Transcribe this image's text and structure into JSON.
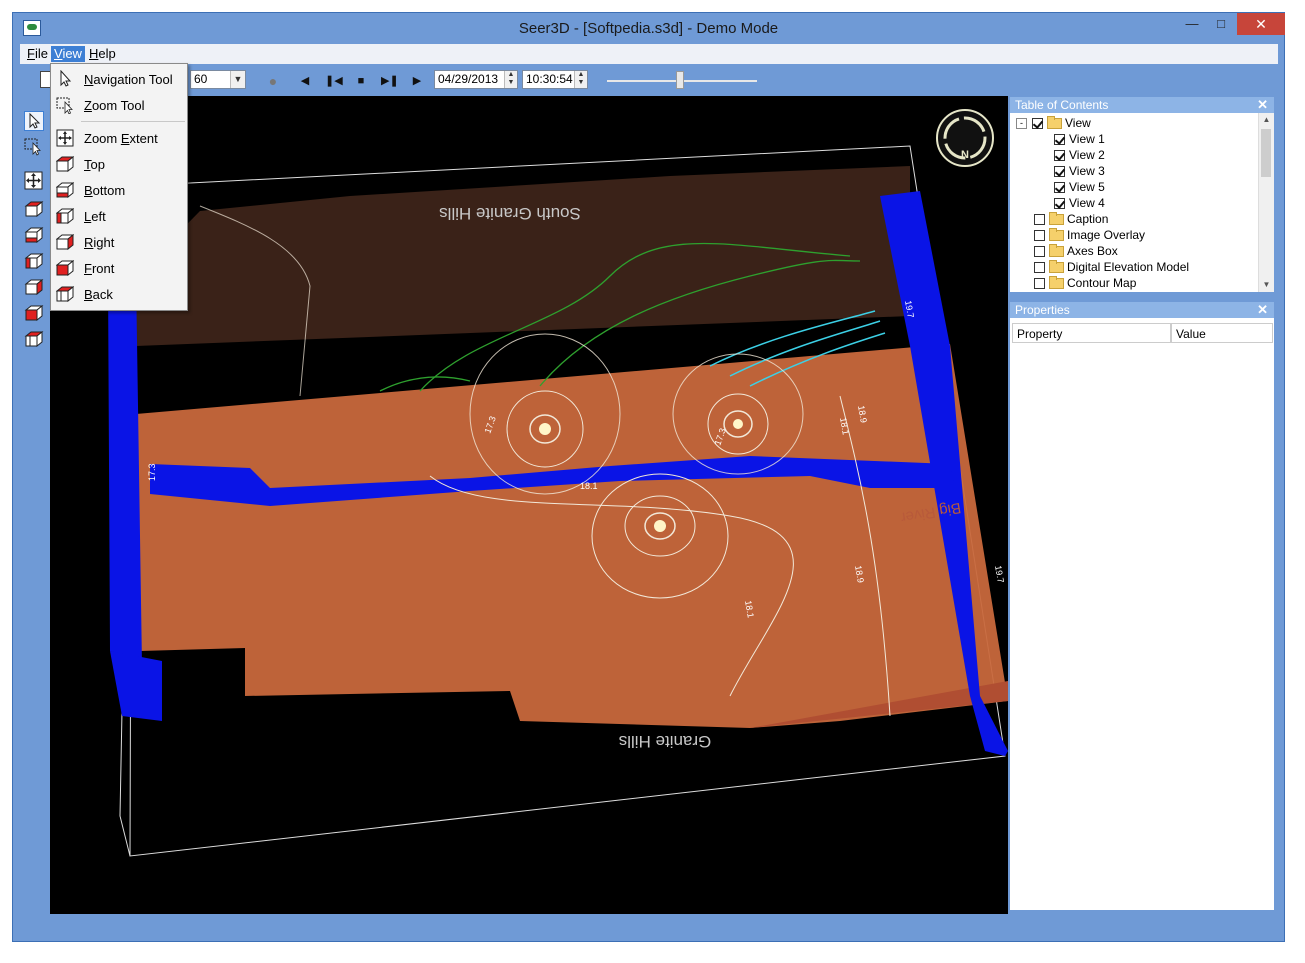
{
  "window": {
    "title": "Seer3D - [Softpedia.s3d] - Demo Mode",
    "minimize_icon": "minimize-icon",
    "maximize_icon": "maximize-icon",
    "close_icon": "close-icon"
  },
  "menubar": {
    "items": [
      {
        "label": "File",
        "access": "F",
        "rest": "ile"
      },
      {
        "label": "View",
        "access": "V",
        "rest": "iew"
      },
      {
        "label": "Help",
        "access": "H",
        "rest": "elp"
      }
    ]
  },
  "view_menu": {
    "items": [
      {
        "label": "Navigation Tool",
        "access": "N",
        "rest": "avigation Tool",
        "icon": "arrow-cursor-icon"
      },
      {
        "label": "Zoom Tool",
        "access": "Z",
        "rest": "oom Tool",
        "icon": "zoom-select-icon"
      },
      {
        "label": "Zoom Extent",
        "pre": "Zoom ",
        "access": "E",
        "rest": "xtent",
        "icon": "zoom-extent-icon"
      },
      {
        "label": "Top",
        "access": "T",
        "rest": "op",
        "icon": "view-top-icon"
      },
      {
        "label": "Bottom",
        "access": "B",
        "rest": "ottom",
        "icon": "view-bottom-icon"
      },
      {
        "label": "Left",
        "access": "L",
        "rest": "eft",
        "icon": "view-left-icon"
      },
      {
        "label": "Right",
        "access": "R",
        "rest": "ight",
        "icon": "view-right-icon"
      },
      {
        "label": "Front",
        "access": "F",
        "rest": "ront",
        "icon": "view-front-icon"
      },
      {
        "label": "Back",
        "access": "B",
        "rest": "ack",
        "icon": "view-back-icon"
      }
    ]
  },
  "toolbar": {
    "speed_value": "60",
    "date_value": "04/29/2013",
    "time_value": "10:30:54",
    "record_icon": "record-icon",
    "first_icon": "first-frame-icon",
    "step_back_icon": "step-back-icon",
    "stop_icon": "stop-icon",
    "step_forward_icon": "step-forward-icon",
    "play_icon": "play-icon",
    "time_slider_position": 0.47
  },
  "viewport": {
    "labels": {
      "north_hills": "South Granite Hills",
      "south_hills": "Granite Hills",
      "river": "Big River"
    },
    "contour_labels": [
      "18.1",
      "18.9",
      "19.7",
      "17.3",
      "18.1",
      "18.9",
      "17.3",
      "19.7",
      "18.1",
      "17.3"
    ],
    "compass_label": "N",
    "colors": {
      "background": "#000000",
      "surface_front": "#c8683c",
      "surface_back": "#3a2218",
      "water_blue": "#0a14e6",
      "contour_white": "#f2e8d8",
      "contour_green": "#2ea02e",
      "contour_cyan": "#3cd0e6"
    }
  },
  "toc": {
    "title": "Table of Contents",
    "items": [
      {
        "label": "View",
        "checked": true,
        "folder": true,
        "indent": 0,
        "expander": "-"
      },
      {
        "label": "View 1",
        "checked": true,
        "folder": false,
        "indent": 1
      },
      {
        "label": "View 2",
        "checked": true,
        "folder": false,
        "indent": 1
      },
      {
        "label": "View 3",
        "checked": true,
        "folder": false,
        "indent": 1
      },
      {
        "label": "View 5",
        "checked": true,
        "folder": false,
        "indent": 1
      },
      {
        "label": "View 4",
        "checked": true,
        "folder": false,
        "indent": 1
      },
      {
        "label": "Caption",
        "checked": false,
        "folder": true,
        "indent": 0
      },
      {
        "label": "Image Overlay",
        "checked": false,
        "folder": true,
        "indent": 0
      },
      {
        "label": "Axes Box",
        "checked": false,
        "folder": true,
        "indent": 0
      },
      {
        "label": "Digital Elevation Model",
        "checked": false,
        "folder": true,
        "indent": 0
      },
      {
        "label": "Contour Map",
        "checked": false,
        "folder": true,
        "indent": 0
      }
    ]
  },
  "properties": {
    "title": "Properties",
    "columns": [
      "Property",
      "Value"
    ]
  }
}
